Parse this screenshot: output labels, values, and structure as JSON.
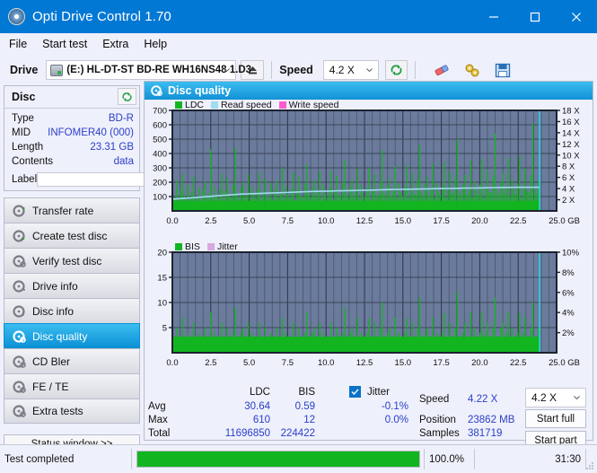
{
  "window": {
    "title": "Opti Drive Control 1.70",
    "icon": "disc-icon",
    "minimize": "–",
    "maximize": "□",
    "close": "×"
  },
  "menu": {
    "items": [
      {
        "label": "File"
      },
      {
        "label": "Start test"
      },
      {
        "label": "Extra"
      },
      {
        "label": "Help"
      }
    ]
  },
  "toolbar": {
    "drive_label": "Drive",
    "drive_value": "(E:)  HL-DT-ST BD-RE  WH16NS48 1.D3",
    "eject_icon": "eject-icon",
    "speed_label": "Speed",
    "speed_value": "4.2 X",
    "refresh_icon": "refresh-icon",
    "erase_icon": "eraser-icon",
    "tools_icon": "tools-icon",
    "save_icon": "save-icon"
  },
  "disc_panel": {
    "title": "Disc",
    "refresh_icon": "refresh-icon",
    "rows": [
      {
        "key": "Type",
        "value": "BD-R"
      },
      {
        "key": "MID",
        "value": "INFOMER40 (000)"
      },
      {
        "key": "Length",
        "value": "23.31 GB"
      },
      {
        "key": "Contents",
        "value": "data"
      }
    ],
    "label_key": "Label",
    "label_value": "",
    "label_icon": "disc-icon"
  },
  "sidebar": {
    "items": [
      {
        "label": "Transfer rate",
        "icon": "transfer-rate-icon",
        "active": false
      },
      {
        "label": "Create test disc",
        "icon": "create-test-disc-icon",
        "active": false
      },
      {
        "label": "Verify test disc",
        "icon": "verify-test-disc-icon",
        "active": false
      },
      {
        "label": "Drive info",
        "icon": "drive-info-icon",
        "active": false
      },
      {
        "label": "Disc info",
        "icon": "disc-info-icon",
        "active": false
      },
      {
        "label": "Disc quality",
        "icon": "disc-quality-icon",
        "active": true
      },
      {
        "label": "CD Bler",
        "icon": "cd-bler-icon",
        "active": false
      },
      {
        "label": "FE / TE",
        "icon": "fe-te-icon",
        "active": false
      },
      {
        "label": "Extra tests",
        "icon": "extra-tests-icon",
        "active": false
      }
    ],
    "status_window_button": "Status window >>"
  },
  "content": {
    "title": "Disc quality",
    "icon": "disc-quality-icon"
  },
  "stats": {
    "col_headers": [
      "LDC",
      "BIS"
    ],
    "row_labels": [
      "Avg",
      "Max",
      "Total"
    ],
    "ldc": {
      "avg": "30.64",
      "max": "610",
      "total": "11696850"
    },
    "bis": {
      "avg": "0.59",
      "max": "12",
      "total": "224422"
    },
    "jitter": {
      "label": "Jitter",
      "checked": true,
      "avg": "-0.1%",
      "max": "0.0%"
    },
    "speed_label": "Speed",
    "speed_value": "4.22 X",
    "position_label": "Position",
    "position_value": "23862 MB",
    "samples_label": "Samples",
    "samples_value": "381719",
    "speed_select": "4.2 X",
    "start_full_button": "Start full",
    "start_part_button": "Start part"
  },
  "statusbar": {
    "message": "Test completed",
    "progress_percent_label": "100.0%",
    "progress_value": 100,
    "elapsed": "31:30"
  },
  "colors": {
    "accent": "#0078d4",
    "ldc": "#12b520",
    "bis": "#12b520",
    "read_speed": "#9fdcf0",
    "write_speed": "#ff5ccd",
    "jitter": "#d9a8e0",
    "plot_bg": "#6b7b9c",
    "value_text": "#2b3ec9",
    "marker": "#27e0f5"
  },
  "chart_data": [
    {
      "type": "bar",
      "name": "disc-quality-ldc",
      "title": "",
      "xlabel": "GB",
      "ylabel": "",
      "legend": [
        {
          "label": "LDC",
          "color": "#12b520"
        },
        {
          "label": "Read speed",
          "color": "#9fdcf0"
        },
        {
          "label": "Write speed",
          "color": "#ff5ccd"
        }
      ],
      "legend_position": "top-left",
      "grid": true,
      "x": [
        0.0,
        25.0
      ],
      "xticks": [
        "0.0",
        "2.5",
        "5.0",
        "7.5",
        "10.0",
        "12.5",
        "15.0",
        "17.5",
        "20.0",
        "22.5",
        "25.0 GB"
      ],
      "ylim": [
        0,
        700
      ],
      "yticks": [
        "100",
        "200",
        "300",
        "400",
        "500",
        "600",
        "700"
      ],
      "y2lim": [
        0,
        18
      ],
      "y2ticks": [
        "2 X",
        "4 X",
        "6 X",
        "8 X",
        "10 X",
        "12 X",
        "14 X",
        "16 X",
        "18 X"
      ],
      "data_end_gb": 23.9,
      "series": [
        {
          "name": "LDC",
          "color": "#12b520",
          "type": "bar",
          "values": [
            120,
            95,
            210,
            80,
            150,
            260,
            110,
            90,
            185,
            75,
            130,
            240,
            100,
            88,
            165,
            70,
            145,
            205,
            95,
            120,
            430,
            85,
            175,
            110,
            92,
            150,
            260,
            78,
            140,
            230,
            105,
            95,
            180,
            440,
            115,
            88,
            160,
            200,
            98,
            125,
            255,
            82,
            170,
            115,
            90,
            148,
            270,
            80,
            135,
            225,
            102,
            98,
            195,
            72,
            152,
            210,
            96,
            128,
            300,
            86,
            178,
            118,
            94,
            155,
            265,
            76,
            142,
            235,
            108,
            100,
            190,
            330,
            118,
            92,
            168,
            215,
            99,
            132,
            275,
            84,
            182,
            122,
            97,
            158,
            280,
            74,
            138,
            245,
            112,
            104,
            200,
            350,
            122,
            96,
            172,
            220,
            101,
            136,
            290,
            88,
            186,
            126,
            100,
            162,
            300,
            82,
            146,
            255,
            116,
            108,
            205,
            420,
            126,
            100,
            176,
            228,
            105,
            140,
            310,
            92,
            190,
            130,
            104,
            168,
            320,
            86,
            152,
            265,
            120,
            112,
            215,
            460,
            132,
            104,
            182,
            238,
            110,
            146,
            330,
            96,
            198,
            136,
            108,
            175,
            340,
            90,
            158,
            275,
            126,
            118,
            225,
            500,
            138,
            110,
            190,
            250,
            116,
            152,
            350,
            100,
            206,
            142,
            112,
            182,
            360,
            94,
            165,
            288,
            132,
            124,
            235,
            540,
            146,
            116,
            200,
            262,
            122,
            160,
            370,
            106,
            215,
            150,
            118,
            190,
            380,
            98,
            172,
            300,
            140,
            130,
            248,
            610,
            154,
            122,
            210
          ]
        },
        {
          "name": "Read speed",
          "color": "#9fdcf0",
          "type": "line",
          "axis": "y2",
          "values": [
            2.1,
            2.2,
            2.3,
            2.4,
            2.5,
            2.6,
            2.7,
            2.8,
            2.9,
            3.0,
            3.05,
            3.1,
            3.15,
            3.2,
            3.25,
            3.3,
            3.35,
            3.4,
            3.45,
            3.5,
            3.52,
            3.55,
            3.6,
            3.62,
            3.65,
            3.7,
            3.72,
            3.75,
            3.8,
            3.82,
            3.85,
            3.88,
            3.9,
            3.92,
            3.95,
            3.98,
            4.0,
            4.02,
            4.05,
            4.08,
            4.1,
            4.12,
            4.15,
            4.18,
            4.2,
            4.21,
            4.22,
            4.22,
            4.22,
            4.22
          ]
        }
      ],
      "markers": [
        {
          "type": "vline",
          "x": 23.9,
          "color": "#27e0f5"
        }
      ]
    },
    {
      "type": "bar",
      "name": "disc-quality-bis",
      "title": "",
      "xlabel": "GB",
      "ylabel": "",
      "legend": [
        {
          "label": "BIS",
          "color": "#12b520"
        },
        {
          "label": "Jitter",
          "color": "#d9a8e0"
        }
      ],
      "legend_position": "top-left",
      "grid": true,
      "x": [
        0.0,
        25.0
      ],
      "xticks": [
        "0.0",
        "2.5",
        "5.0",
        "7.5",
        "10.0",
        "12.5",
        "15.0",
        "17.5",
        "20.0",
        "22.5",
        "25.0 GB"
      ],
      "ylim": [
        0,
        20
      ],
      "yticks": [
        "5",
        "10",
        "15",
        "20"
      ],
      "y2lim": [
        0,
        10
      ],
      "y2ticks": [
        "2%",
        "4%",
        "6%",
        "8%",
        "10%"
      ],
      "data_end_gb": 23.9,
      "series": [
        {
          "name": "BIS",
          "color": "#12b520",
          "type": "bar",
          "values": [
            3,
            2,
            5,
            2,
            3,
            7,
            2,
            2,
            4,
            1,
            3,
            6,
            2,
            2,
            4,
            1,
            3,
            5,
            2,
            3,
            8,
            2,
            4,
            2,
            2,
            3,
            6,
            1,
            3,
            5,
            2,
            2,
            4,
            9,
            3,
            2,
            4,
            5,
            2,
            3,
            6,
            2,
            4,
            3,
            2,
            3,
            6,
            2,
            3,
            5,
            2,
            2,
            4,
            1,
            3,
            5,
            2,
            3,
            7,
            2,
            4,
            3,
            2,
            3,
            6,
            1,
            3,
            5,
            2,
            2,
            4,
            8,
            3,
            2,
            4,
            5,
            2,
            3,
            6,
            2,
            4,
            3,
            2,
            3,
            6,
            1,
            3,
            5,
            2,
            2,
            4,
            9,
            3,
            2,
            4,
            5,
            2,
            3,
            7,
            2,
            4,
            3,
            2,
            4,
            7,
            2,
            3,
            6,
            3,
            2,
            5,
            10,
            3,
            2,
            4,
            5,
            2,
            3,
            7,
            2,
            4,
            3,
            2,
            4,
            7,
            2,
            3,
            6,
            3,
            2,
            5,
            11,
            3,
            2,
            4,
            5,
            2,
            3,
            7,
            2,
            4,
            3,
            2,
            4,
            8,
            2,
            3,
            6,
            3,
            2,
            5,
            12,
            3,
            2,
            4,
            6,
            2,
            3,
            8,
            2,
            5,
            3,
            2,
            4,
            8,
            2,
            4,
            6,
            3,
            3,
            5,
            11,
            3,
            2,
            5,
            6,
            3,
            4,
            8,
            2,
            5,
            3,
            2,
            4,
            8,
            2,
            4,
            7,
            3,
            3,
            5,
            10,
            3,
            2,
            5
          ]
        },
        {
          "name": "Jitter",
          "color": "#d9a8e0",
          "type": "line",
          "axis": "y2",
          "values": []
        }
      ],
      "markers": [
        {
          "type": "vline",
          "x": 23.9,
          "color": "#27e0f5"
        }
      ]
    }
  ]
}
